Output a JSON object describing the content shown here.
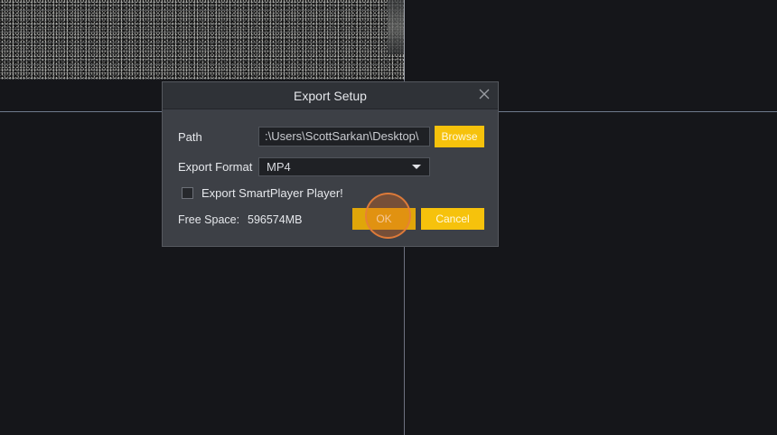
{
  "dialog": {
    "title": "Export Setup",
    "path_label": "Path",
    "path_value": ":\\Users\\ScottSarkan\\Desktop\\",
    "browse_label": "Browse",
    "format_label": "Export Format",
    "format_value": "MP4",
    "checkbox_label": "Export SmartPlayer Player!",
    "checkbox_checked": false,
    "free_space_label": "Free Space:",
    "free_space_value": "596574MB",
    "ok_label": "OK",
    "cancel_label": "Cancel"
  },
  "colors": {
    "accent": "#f6c20c",
    "dialog_bg": "#3d4046",
    "titlebar_bg": "#2f3237",
    "canvas_bg": "#15161a",
    "click_highlight": "#e8803a"
  },
  "icons": {
    "close": "close-icon",
    "dropdown": "chevron-down-icon"
  }
}
